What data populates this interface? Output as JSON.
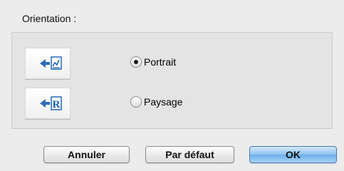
{
  "orientation": {
    "title": "Orientation :",
    "options": [
      {
        "label": "Portrait",
        "icon": "portrait-orientation-icon",
        "selected": true
      },
      {
        "label": "Paysage",
        "icon": "landscape-orientation-icon",
        "selected": false
      }
    ]
  },
  "buttons": {
    "cancel_label": "Annuler",
    "default_label": "Par défaut",
    "ok_label": "OK"
  },
  "colors": {
    "accent_blue": "#1a5fb4",
    "primary_button": "#8cc2f1"
  }
}
